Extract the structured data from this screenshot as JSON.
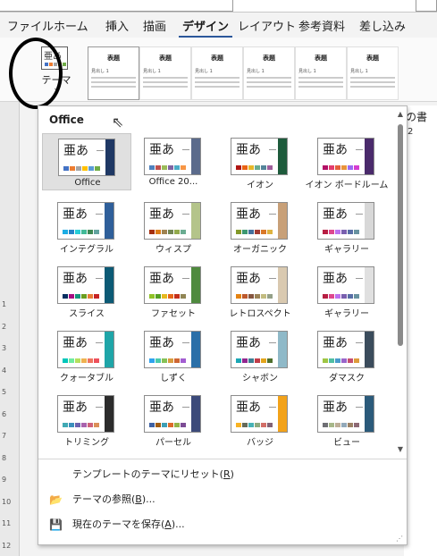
{
  "menu": [
    {
      "label": "ファイル"
    },
    {
      "label": "ホーム"
    },
    {
      "label": "挿入"
    },
    {
      "label": "描画"
    },
    {
      "label": "デザイン",
      "active": true
    },
    {
      "label": "レイアウト"
    },
    {
      "label": "参考資料"
    },
    {
      "label": "差し込み"
    }
  ],
  "ribbon": {
    "theme_button": {
      "thumb_char": "亜あ",
      "label": "テーマ",
      "chevron": "⌄"
    },
    "style_cards": [
      {
        "title": "表題",
        "subtitle": "見出し 1"
      },
      {
        "title": "表題",
        "subtitle": "見出し 1"
      },
      {
        "title": "表題",
        "subtitle": "見出し 1"
      },
      {
        "title": "表題",
        "subtitle": "見出し 1"
      },
      {
        "title": "表題",
        "subtitle": "見出し 1"
      },
      {
        "title": "表題",
        "subtitle": "見出し 1"
      }
    ]
  },
  "right_pane": {
    "title_fragment": "の書",
    "number_fragment": "2"
  },
  "ruler": {
    "ticks": [
      "1",
      "2",
      "3",
      "4",
      "5",
      "6",
      "7",
      "8",
      "9",
      "10",
      "11",
      "12"
    ]
  },
  "panel": {
    "header": "Office",
    "thumb_char": "亜あ",
    "themes": [
      {
        "name": "Office",
        "accent": "#1f3864",
        "bars": [
          "#4472c4",
          "#ed7d31",
          "#a5a5a5",
          "#ffc000",
          "#5b9bd5",
          "#70ad47"
        ],
        "selected": true
      },
      {
        "name": "Office 20...",
        "accent": "#5b6b8c",
        "bars": [
          "#4f81bd",
          "#c0504d",
          "#9bbb59",
          "#8064a2",
          "#4bacc6",
          "#f79646"
        ]
      },
      {
        "name": "イオン",
        "accent": "#1e5b3c",
        "bars": [
          "#b01513",
          "#ea6312",
          "#e6b729",
          "#6aac90",
          "#54849a",
          "#9e5e9b"
        ]
      },
      {
        "name": "イオン ボードルーム",
        "accent": "#4a2a6b",
        "bars": [
          "#b31166",
          "#e33d6f",
          "#e45f3c",
          "#e9943a",
          "#9b6bf2",
          "#d53dd0"
        ]
      },
      {
        "name": "インテグラル",
        "accent": "#2f5f9a",
        "bars": [
          "#1cade4",
          "#2683c6",
          "#27ced7",
          "#42ba97",
          "#3e8853",
          "#62a39f"
        ]
      },
      {
        "name": "ウィスプ",
        "accent": "#b4c48a",
        "bars": [
          "#a53010",
          "#de7e18",
          "#9f8351",
          "#728653",
          "#92aa4c",
          "#6aac91"
        ]
      },
      {
        "name": "オーガニック",
        "accent": "#c8a078",
        "bars": [
          "#83992a",
          "#3c9770",
          "#44709d",
          "#a23c33",
          "#d97828",
          "#deb340"
        ]
      },
      {
        "name": "ギャラリー",
        "accent": "#d8d8d8",
        "bars": [
          "#b71e42",
          "#de478e",
          "#bc72f0",
          "#795faf",
          "#586ea6",
          "#6892a0"
        ]
      },
      {
        "name": "スライス",
        "accent": "#0c5a75",
        "bars": [
          "#052f61",
          "#a50e82",
          "#14967c",
          "#6a9e1f",
          "#e87d37",
          "#c62324"
        ]
      },
      {
        "name": "ファセット",
        "accent": "#4f8a3e",
        "bars": [
          "#90c226",
          "#54a021",
          "#e6b91e",
          "#e76618",
          "#c42f1a",
          "#918655"
        ]
      },
      {
        "name": "レトロスペクト",
        "accent": "#d9c9b0",
        "bars": [
          "#e48312",
          "#bd582c",
          "#865640",
          "#9b8357",
          "#c2bc80",
          "#94a088"
        ]
      },
      {
        "name": "ギャラリー",
        "accent": "#e0e0e0",
        "bars": [
          "#b71e42",
          "#de478e",
          "#bc72f0",
          "#795faf",
          "#586ea6",
          "#6892a0"
        ]
      },
      {
        "name": "クォータブル",
        "accent": "#1fa5a8",
        "bars": [
          "#00c6bb",
          "#6feba0",
          "#b6df5e",
          "#efb251",
          "#ef755f",
          "#ed515c"
        ]
      },
      {
        "name": "しずく",
        "accent": "#2a6fa8",
        "bars": [
          "#2fa3ee",
          "#4bcaad",
          "#86c157",
          "#d99c3f",
          "#ce6633",
          "#a35dd1"
        ]
      },
      {
        "name": "シャボン",
        "accent": "#8fb9c8",
        "bars": [
          "#1ca7b5",
          "#92278f",
          "#3d7f93",
          "#c13d49",
          "#e3a51d",
          "#4e6f2c"
        ]
      },
      {
        "name": "ダマスク",
        "accent": "#3b4c5c",
        "bars": [
          "#9ec544",
          "#50bea3",
          "#4a9ccc",
          "#9a66ca",
          "#c54f71",
          "#de9c3c"
        ]
      },
      {
        "name": "トリミング",
        "accent": "#2c2c2c",
        "bars": [
          "#40a9b4",
          "#3b8fbd",
          "#6d62b0",
          "#a862ad",
          "#ce627a",
          "#db8f58"
        ]
      },
      {
        "name": "パーセル",
        "accent": "#3c4a7a",
        "bars": [
          "#3e61a3",
          "#a15c0f",
          "#3c9fb5",
          "#dc6b2a",
          "#94b447",
          "#7c4c95"
        ]
      },
      {
        "name": "バッジ",
        "accent": "#f2a21a",
        "bars": [
          "#f8b323",
          "#656a59",
          "#46b2b5",
          "#8caa7e",
          "#d36f68",
          "#826276"
        ]
      },
      {
        "name": "ビュー",
        "accent": "#2b5a7a",
        "bars": [
          "#6f6f74",
          "#a7b789",
          "#beae98",
          "#92a9b9",
          "#9c8265",
          "#8d6974"
        ]
      }
    ],
    "commands": [
      {
        "icon": "",
        "label": "テンプレートのテーマにリセット(",
        "key": "R",
        "suffix": ")"
      },
      {
        "icon": "📂",
        "label": "テーマの参照(",
        "key": "B",
        "suffix": ")..."
      },
      {
        "icon": "💾",
        "label": "現在のテーマを保存(",
        "key": "A",
        "suffix": ")..."
      }
    ]
  }
}
